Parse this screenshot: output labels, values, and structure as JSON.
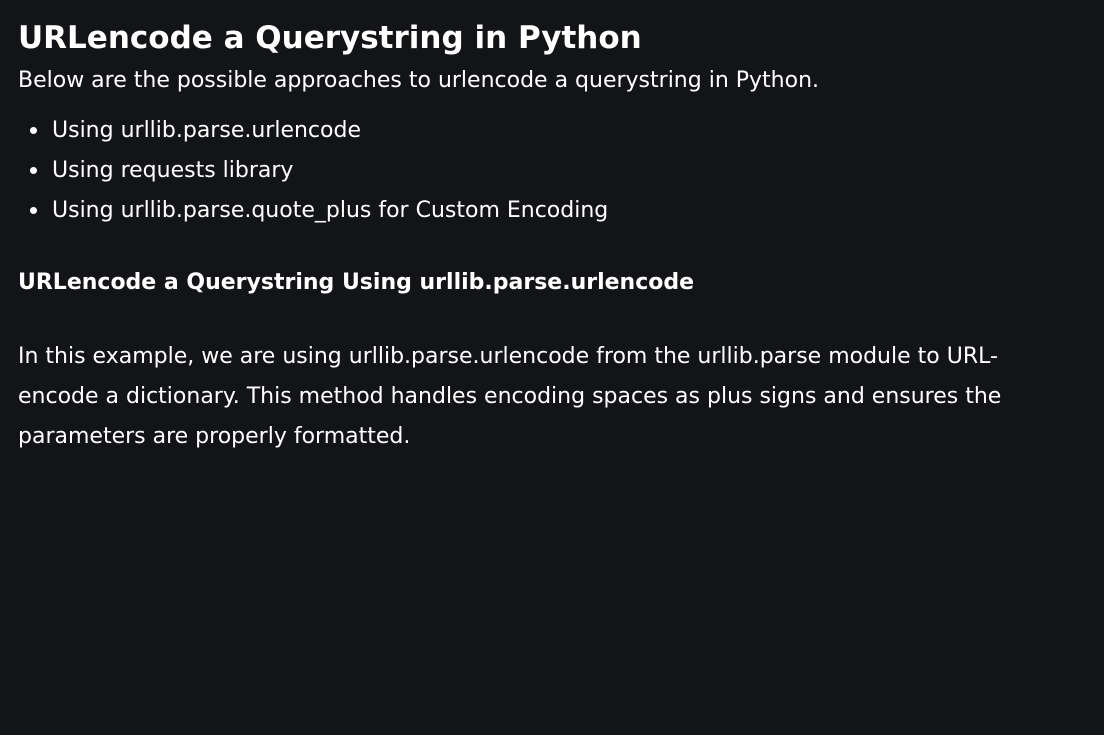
{
  "article": {
    "title": "URLencode a Querystring in Python",
    "intro": "Below are the possible approaches to urlencode a querystring in Python.",
    "approaches": [
      "Using urllib.parse.urlencode",
      "Using requests library",
      "Using urllib.parse.quote_plus for Custom Encoding"
    ],
    "section": {
      "heading": "URLencode a Querystring Using urllib.parse.urlencode",
      "body": "In this example, we are using urllib.parse.urlencode from the urllib.parse module to URL-encode a dictionary. This method handles encoding spaces as plus signs and ensures the parameters are properly formatted."
    }
  },
  "colors": {
    "background": "#131417",
    "text": "#ffffff"
  }
}
